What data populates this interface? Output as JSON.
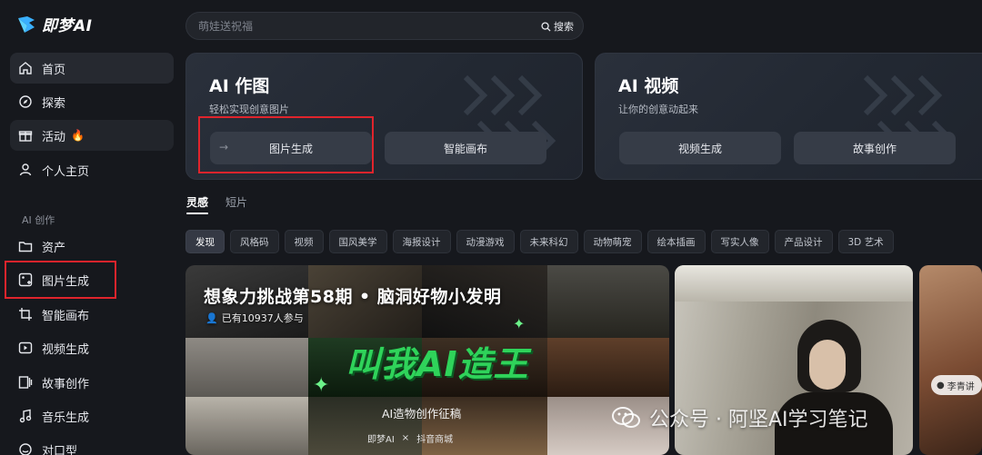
{
  "app": {
    "name": "即梦AI"
  },
  "sidebar": {
    "items": [
      {
        "label": "首页",
        "icon": "home-icon"
      },
      {
        "label": "探索",
        "icon": "compass-icon"
      },
      {
        "label": "活动",
        "icon": "gift-icon",
        "badge": "flame-icon"
      },
      {
        "label": "个人主页",
        "icon": "user-icon"
      }
    ],
    "section_label": "AI 创作",
    "create_items": [
      {
        "label": "资产",
        "icon": "folder-icon"
      },
      {
        "label": "图片生成",
        "icon": "image-plus-icon"
      },
      {
        "label": "智能画布",
        "icon": "crop-icon"
      },
      {
        "label": "视频生成",
        "icon": "video-plus-icon"
      },
      {
        "label": "故事创作",
        "icon": "story-icon"
      },
      {
        "label": "音乐生成",
        "icon": "music-icon"
      },
      {
        "label": "对口型",
        "icon": "lipsync-icon"
      }
    ]
  },
  "search": {
    "placeholder": "萌娃送祝福",
    "button_label": "搜索"
  },
  "cards": [
    {
      "title": "AI 作图",
      "subtitle": "轻松实现创意图片",
      "buttons": [
        "图片生成",
        "智能画布"
      ]
    },
    {
      "title": "AI 视频",
      "subtitle": "让你的创意动起来",
      "buttons": [
        "视频生成",
        "故事创作"
      ]
    }
  ],
  "tabs": [
    "灵感",
    "短片"
  ],
  "filters": [
    "发现",
    "风格码",
    "视频",
    "国风美学",
    "海报设计",
    "动漫游戏",
    "未来科幻",
    "动物萌宠",
    "绘本插画",
    "写实人像",
    "产品设计",
    "3D 艺术"
  ],
  "banner": {
    "title": "想象力挑战第58期 • 脑洞好物小发明",
    "participants": "已有10937人参与",
    "headline": "叫我AI造王",
    "subline": "AI造物创作征稿",
    "brand1": "即梦AI",
    "separator": "×",
    "brand2": "抖音商城"
  },
  "tile3_label": "李青讲",
  "watermark": "公众号 · 阿坚AI学习笔记",
  "colors": {
    "accent_red": "#e0242c",
    "neon_green": "#2fd35a",
    "bg": "#16181d"
  }
}
